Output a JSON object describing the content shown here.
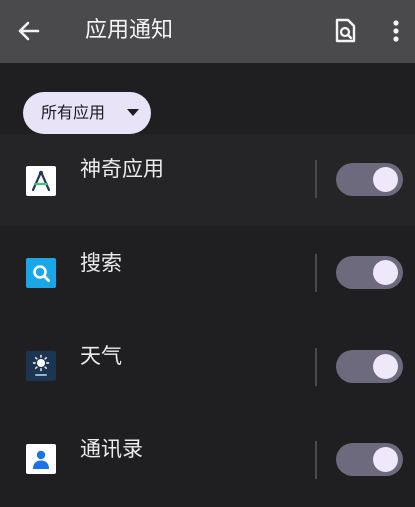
{
  "header": {
    "title": "应用通知",
    "back_icon": "arrow-left-icon",
    "search_icon": "document-search-icon",
    "more_icon": "more-vertical-icon"
  },
  "filter": {
    "selected": "所有应用",
    "arrow_icon": "caret-down-icon"
  },
  "apps": [
    {
      "name": "神奇应用",
      "icon": "android-studio-icon",
      "notifications_on": true
    },
    {
      "name": "搜索",
      "icon": "search-app-icon",
      "notifications_on": true
    },
    {
      "name": "天气",
      "icon": "weather-icon",
      "notifications_on": true
    },
    {
      "name": "通讯录",
      "icon": "contacts-icon",
      "notifications_on": true
    }
  ],
  "colors": {
    "background": "#1f1f21",
    "app_bar": "#4a4a4c",
    "chip": "#e9e3f7",
    "toggle_track": "#6e6a7e",
    "toggle_thumb": "#efe8fb"
  }
}
